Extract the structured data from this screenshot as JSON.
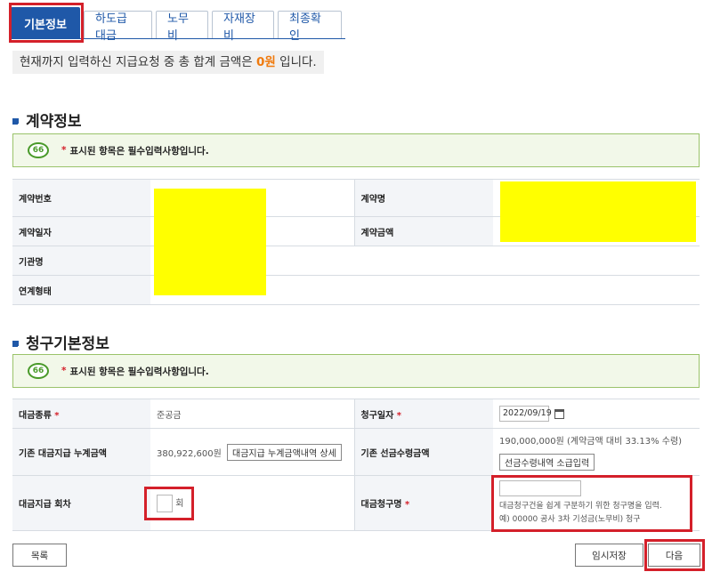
{
  "tabs": [
    {
      "label": "기본정보"
    },
    {
      "label": "하도급 대금"
    },
    {
      "label": "노무비"
    },
    {
      "label": "자재장비"
    },
    {
      "label": "최종확인"
    }
  ],
  "summary": {
    "prefix": "현재까지 입력하신 지급요청 중 총 합계 금액은 ",
    "amount": "0원",
    "suffix": " 입니다."
  },
  "contract": {
    "title": "계약정보",
    "notice": "표시된 항목은 필수입력사항입니다.",
    "fields": {
      "contract_no": "계약번호",
      "contract_name": "계약명",
      "contract_date": "계약일자",
      "contract_amount": "계약금액",
      "agency": "기관명",
      "link_type": "연계형태"
    }
  },
  "claim": {
    "title": "청구기본정보",
    "notice": "표시된 항목은 필수입력사항입니다.",
    "price_type_label": "대금종류",
    "price_type_value": "준공금",
    "claim_date_label": "청구일자",
    "claim_date_value": "2022/09/19",
    "cumulative_label": "기존 대금지급 누계금액",
    "cumulative_value": "380,922,600원",
    "cumulative_button": "대금지급 누계금액내역 상세",
    "advance_label": "기존 선금수령금액",
    "advance_value": "190,000,000원  (계약금액 대비 33.13% 수령)",
    "advance_button": "선금수령내역 소급입력",
    "round_label": "대금지급 회차",
    "round_value": "",
    "round_unit": "회",
    "claim_name_label": "대금청구명",
    "claim_name_value": "",
    "claim_name_help1": "대금청구건을 쉽게 구분하기 위한 청구명을 입력.",
    "claim_name_help2": "예) 00000 공사 3차 기성금(노무비) 청구"
  },
  "buttons": {
    "list": "목록",
    "temp_save": "임시저장",
    "next": "다음"
  },
  "colors": {
    "accent": "#1f58a8",
    "highlight": "#d4202a",
    "amount": "#f07a0d",
    "redaction": "#ffff00"
  }
}
